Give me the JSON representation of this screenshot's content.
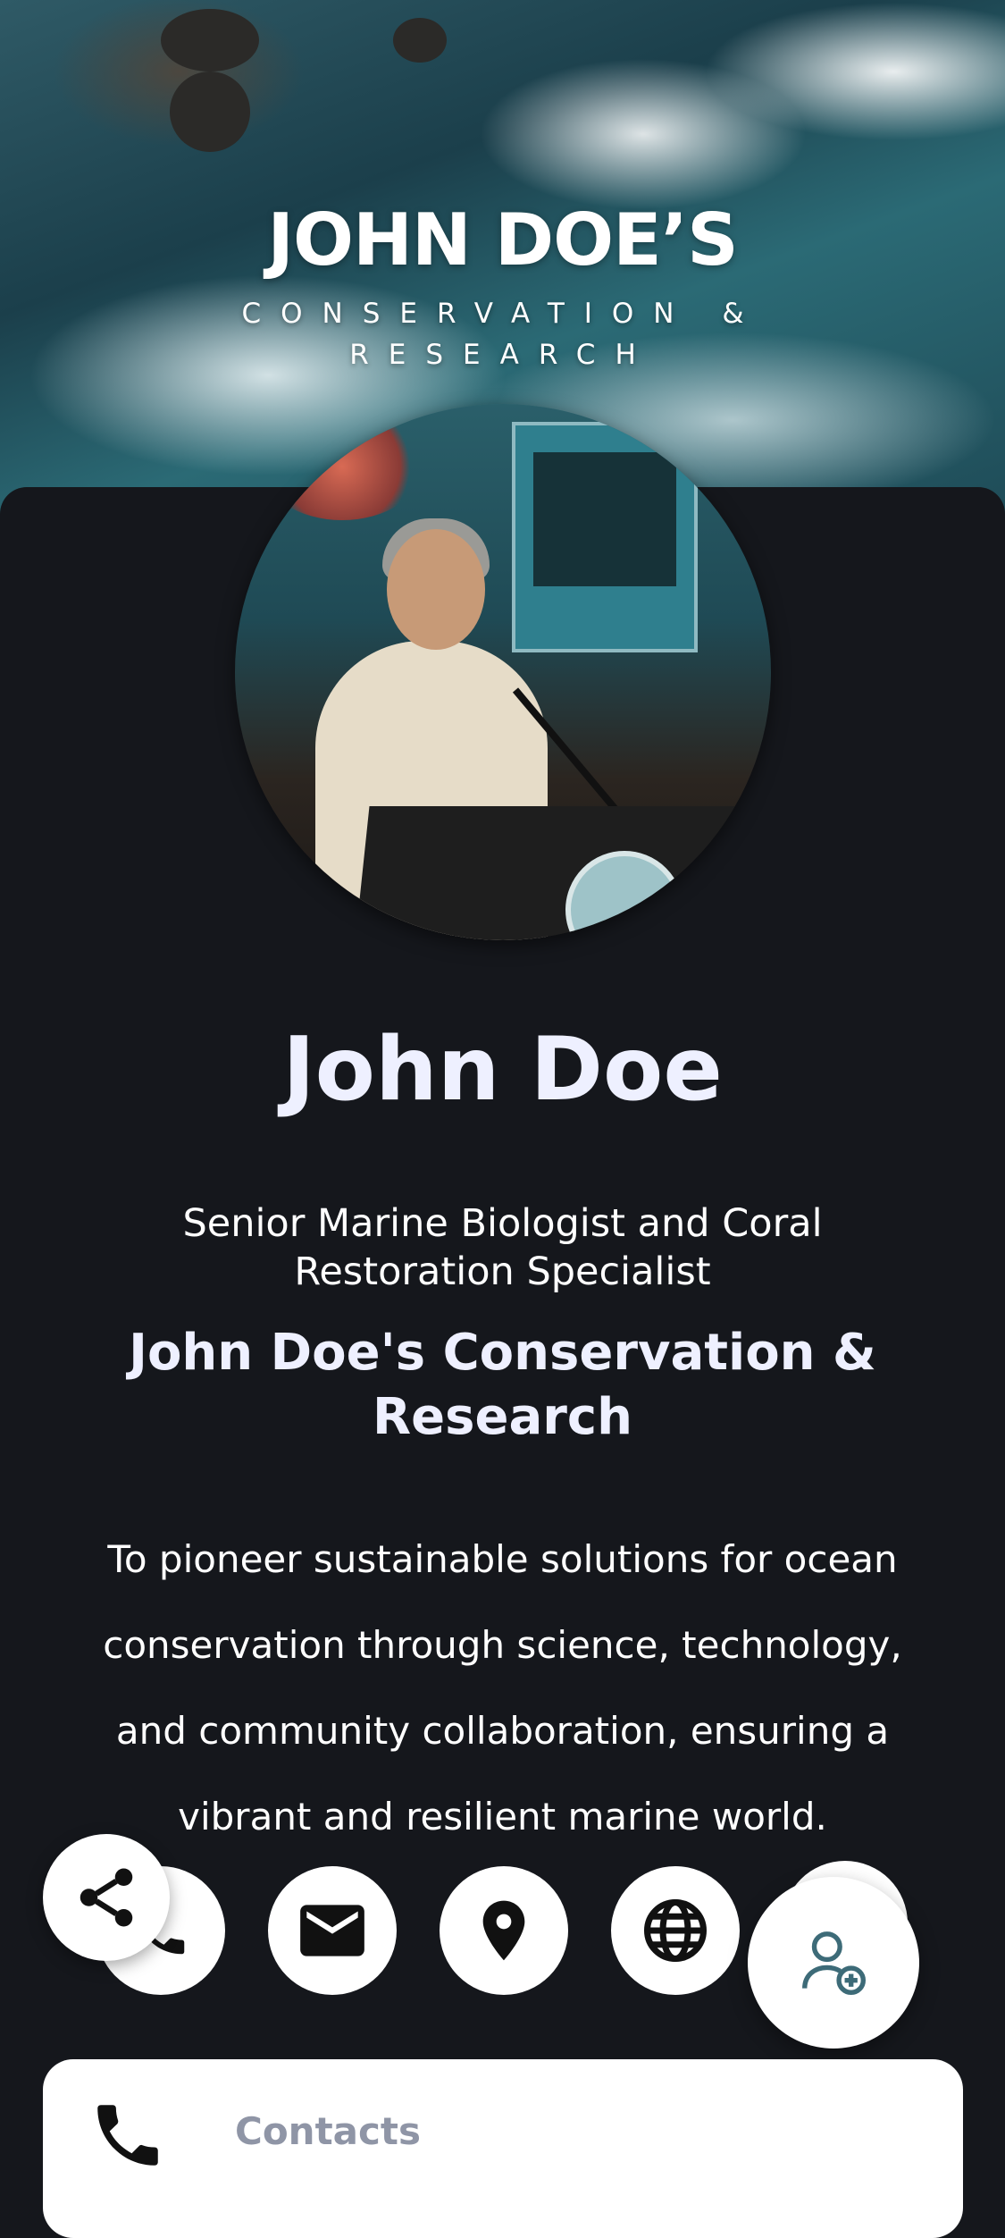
{
  "header": {
    "title": "JOHN DOE’S",
    "subtitle": "CONSERVATION & RESEARCH"
  },
  "profile": {
    "name": "John Doe",
    "role": "Senior Marine Biologist and Coral Restoration Specialist",
    "organization": "John Doe's Conservation & Research",
    "mission": "To pioneer sustainable solutions for ocean conservation through science, technology, and community collaboration, ensuring a vibrant and resilient marine world."
  },
  "actions": [
    {
      "name": "call",
      "icon": "phone-icon"
    },
    {
      "name": "email",
      "icon": "mail-icon"
    },
    {
      "name": "location",
      "icon": "map-pin-icon"
    },
    {
      "name": "website",
      "icon": "globe-icon"
    }
  ],
  "floating": {
    "share_icon": "share-icon",
    "add_contact_icon": "add-contact-icon"
  },
  "contacts_section": {
    "label": "Contacts",
    "icon": "phone-icon"
  },
  "colors": {
    "background": "#15171c",
    "text_heading": "#eef0ff",
    "accent_icon": "#3d6b78",
    "muted_label": "#8f95a6"
  }
}
